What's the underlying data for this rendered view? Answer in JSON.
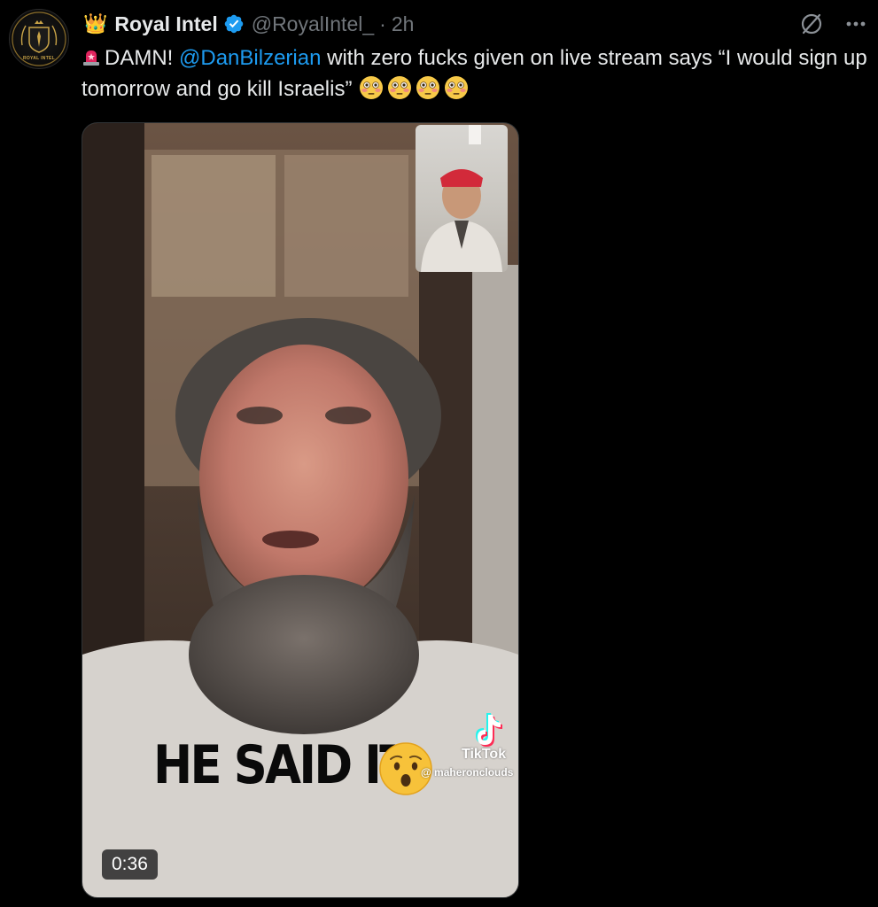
{
  "author": {
    "avatar_text": "ROYAL INTEL",
    "display_name": "Royal Intel",
    "handle": "@RoyalIntel_",
    "separator": "·",
    "timestamp": "2h",
    "crown_emoji": "👑",
    "verified_icon": "verified-badge-icon",
    "verified_color": "#1d9bf0"
  },
  "actions": {
    "grok_icon": "grok-icon",
    "more_icon": "more-icon"
  },
  "tweet": {
    "text_part_1": "DAMN! ",
    "mention": "@DanBilzerian",
    "text_part_2": " with zero fucks given on live stream says “I would sign up tomorrow and go kill Israelis”",
    "leading_emoji": "siren-icon",
    "trailing_emoji": [
      "flushed-face-icon",
      "flushed-face-icon",
      "flushed-face-icon",
      "flushed-face-icon"
    ],
    "mention_color": "#1d9bf0"
  },
  "video": {
    "overlay_text": "HE SAID IT",
    "overlay_emoji": "surprised-face-icon",
    "watermark_brand": "TikTok",
    "watermark_user": "@ maheronclouds",
    "duration": "0:36"
  }
}
